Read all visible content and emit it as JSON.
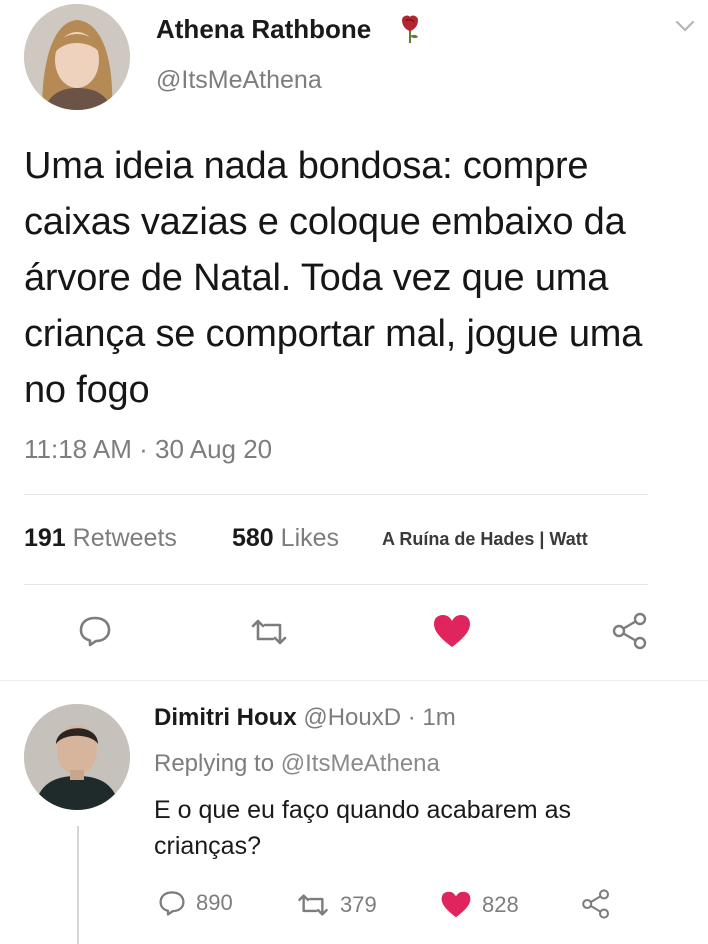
{
  "tweet": {
    "author_name": "Athena Rathbone",
    "author_handle": "@ItsMeAthena",
    "text": "Uma ideia nada bondosa: compre caixas vazias e coloque embaixo da árvore de Natal. Toda vez que uma criança se comportar mal, jogue uma no fogo",
    "timestamp": "11:18 AM · 30 Aug 20",
    "retweets_count": "191",
    "retweets_label": "Retweets",
    "likes_count": "580",
    "likes_label": "Likes",
    "watermark": "A Ruína de Hades | Watt",
    "icons": {
      "menu": "chevron-down-icon",
      "badge": "rose-icon",
      "reply": "reply-bubble-icon",
      "retweet": "retweet-icon",
      "like": "heart-filled-icon",
      "share": "share-icon"
    },
    "colors": {
      "like": "#e0245e",
      "muted": "#7d7d7d"
    }
  },
  "reply": {
    "author_name": "Dimitri Houx",
    "author_handle": "@HouxD",
    "time": "· 1m",
    "replying_prefix": "Replying to",
    "replying_handle": "@ItsMeAthena",
    "text_line1": "E o que eu faço quando acabarem as",
    "text_line2": "crianças?",
    "reply_count": "890",
    "retweet_count": "379",
    "like_count": "828"
  }
}
